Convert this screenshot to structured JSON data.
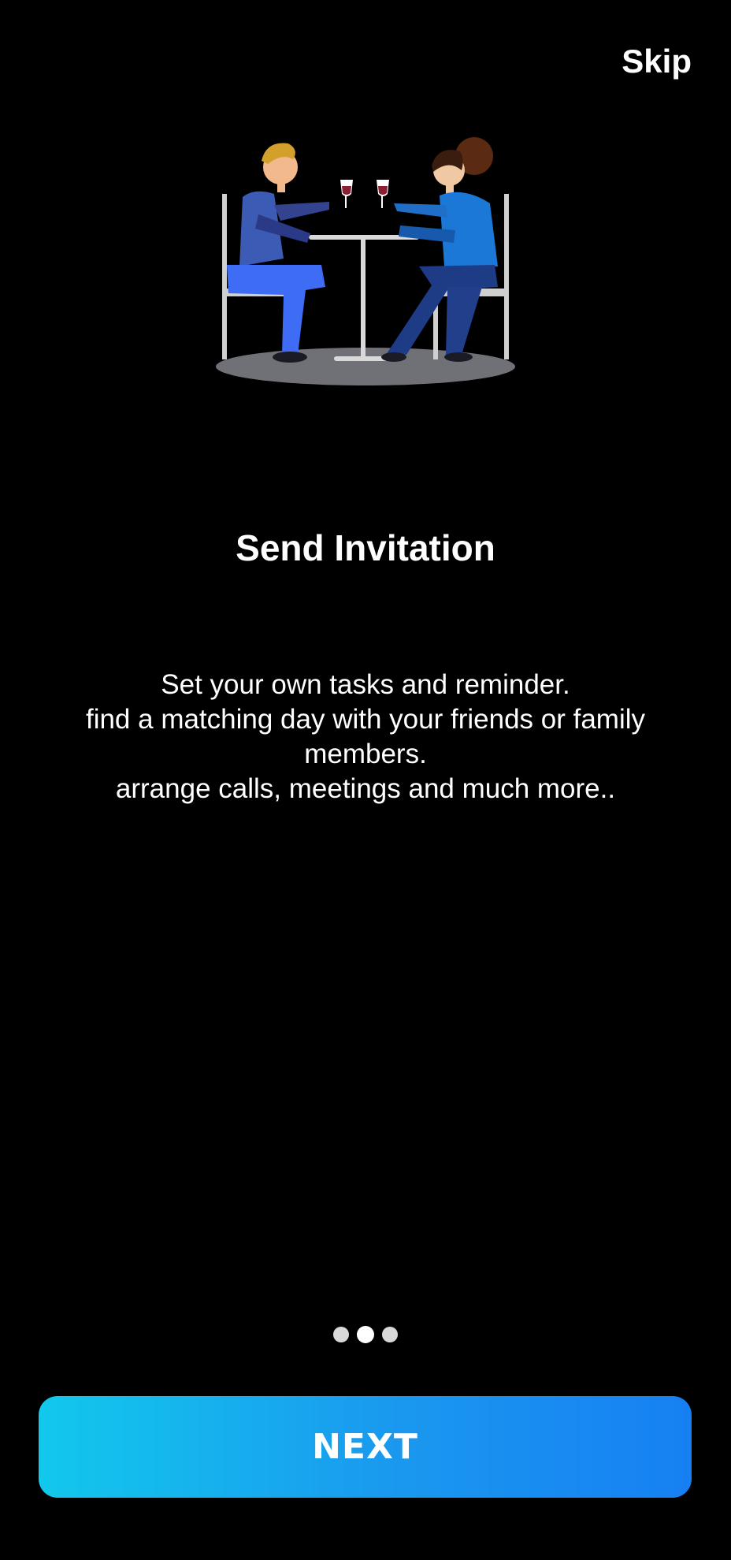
{
  "header": {
    "skip_label": "Skip"
  },
  "illustration": {
    "icon": "couple-dining-illustration"
  },
  "onboarding": {
    "title": "Send Invitation",
    "description_lines": [
      "Set your own tasks and reminder.",
      "find a matching day with your friends or family",
      "members.",
      "arrange calls, meetings and much more.."
    ]
  },
  "pager": {
    "total": 3,
    "active_index": 1
  },
  "footer": {
    "next_label": "NEXT"
  },
  "colors": {
    "background": "#000000",
    "button_gradient_start": "#12c8ec",
    "button_gradient_end": "#1680f3",
    "text": "#ffffff",
    "dot": "#d9d9d9"
  }
}
